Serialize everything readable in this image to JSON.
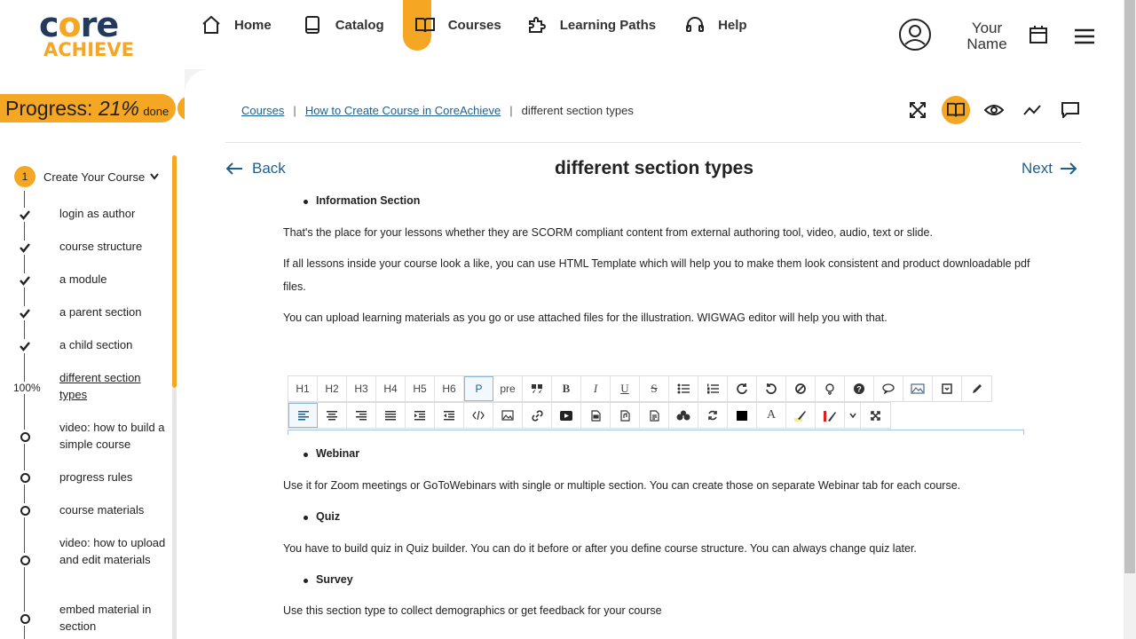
{
  "logo": {
    "line1_a": "c",
    "line1_o": "o",
    "line1_b": "re",
    "line2": "ACHIEVE"
  },
  "nav": [
    {
      "label": "Home",
      "icon": "home-icon"
    },
    {
      "label": "Catalog",
      "icon": "book-closed-icon"
    },
    {
      "label": "Courses",
      "icon": "book-open-icon",
      "active": true
    },
    {
      "label": "Learning Paths",
      "icon": "puzzle-icon"
    },
    {
      "label": "Help",
      "icon": "headset-icon"
    }
  ],
  "user": {
    "name_line1": "Your",
    "name_line2": "Name"
  },
  "sidebar": {
    "progress_prefix": "Progress: ",
    "progress_value": "21%",
    "progress_suffix": "done",
    "progress_fraction": 0.21,
    "chapter_number": "1",
    "chapter_title": "Create Your Course",
    "current_percent": "100%",
    "lessons": [
      {
        "label": "login as author",
        "done": true
      },
      {
        "label": "course structure",
        "done": true
      },
      {
        "label": "a module",
        "done": true
      },
      {
        "label": "a parent section",
        "done": true
      },
      {
        "label": "a child section",
        "done": true
      },
      {
        "label": "different section types",
        "current": true
      },
      {
        "label": "video: how to build a simple course",
        "done": false
      },
      {
        "label": "progress rules",
        "done": false
      },
      {
        "label": "course materials",
        "done": false
      },
      {
        "label": "video: how to upload and edit materials",
        "done": false
      },
      {
        "label": "embed material in section",
        "done": false
      }
    ]
  },
  "breadcrumb": {
    "items": [
      "Courses",
      "How to Create Course in CoreAchieve"
    ],
    "current": "different section types",
    "separator": "|"
  },
  "page": {
    "title": "different section types",
    "back_label": "Back",
    "next_label": "Next"
  },
  "content": {
    "bullet1": "Information Section",
    "p1": "That's the place for your lessons whether they are SCORM compliant content from external authoring tool, video, audio, text or slide.",
    "p2": "If all lessons inside your course look a like, you can use HTML Template which will help you to make them look consistent and product downloadable pdf files.",
    "p3": "You can upload learning materials as you go or use attached files for the illustration. WIGWAG editor will help you with that.",
    "bullet2": "Webinar",
    "p4": "Use it for Zoom  meetings or GoToWebinars with single or multiple section. You can create those on separate Webinar tab for each course.",
    "bullet3": "Quiz",
    "p5": "You have to build quiz in Quiz builder. You can do it before or after you define course structure. You can always change quiz later.",
    "bullet4": "Survey",
    "p6": "Use this section type to collect demographics or get feedback for your course"
  },
  "editor": {
    "row1": [
      "H1",
      "H2",
      "H3",
      "H4",
      "H5",
      "H6",
      "P",
      "pre"
    ]
  },
  "colors": {
    "accent": "#f5a623",
    "link": "#1f5f8b",
    "brand_dark": "#233a5e"
  }
}
